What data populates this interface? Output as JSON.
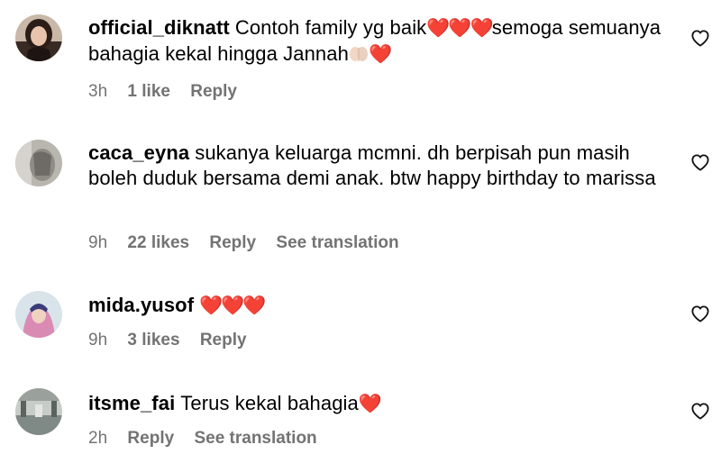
{
  "comments": [
    {
      "username": "official_diknatt",
      "text_a": "Contoh family yg baik",
      "hearts_a": "❤️❤️❤️",
      "text_b": "semoga semuanya bahagia kekal hingga Jannah",
      "hearts_b": "❤️",
      "time": "3h",
      "likes": "1 like",
      "reply": "Reply"
    },
    {
      "username": "caca_eyna",
      "text": "sukanya keluarga mcmni. dh berpisah pun masih boleh duduk bersama demi anak. btw happy birthday to marissa",
      "time": "9h",
      "likes": "22 likes",
      "reply": "Reply",
      "translate": "See translation"
    },
    {
      "username": "mida.yusof",
      "hearts": "❤️❤️❤️",
      "time": "9h",
      "likes": "3 likes",
      "reply": "Reply"
    },
    {
      "username": "itsme_fai",
      "text": "Terus kekal bahagia",
      "hearts": "❤️",
      "time": "2h",
      "reply": "Reply",
      "translate": "See translation"
    }
  ],
  "icons": {
    "like": "heart-outline-icon",
    "praise": "folded-hands-icon"
  },
  "colors": {
    "meta_text": "#737373",
    "heart_emoji": "#e8112d"
  }
}
